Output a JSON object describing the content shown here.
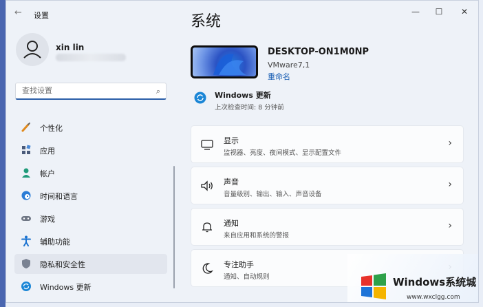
{
  "window": {
    "title": "设置",
    "controls": {
      "minimize": "—",
      "maximize": "☐",
      "close": "✕"
    }
  },
  "user": {
    "name": "xin lin"
  },
  "search": {
    "placeholder": "查找设置"
  },
  "sidebar": {
    "items": [
      {
        "label": "个性化",
        "icon": "brush-icon"
      },
      {
        "label": "应用",
        "icon": "apps-icon"
      },
      {
        "label": "帐户",
        "icon": "account-icon"
      },
      {
        "label": "时间和语言",
        "icon": "globe-clock-icon"
      },
      {
        "label": "游戏",
        "icon": "gamepad-icon"
      },
      {
        "label": "辅助功能",
        "icon": "accessibility-icon"
      },
      {
        "label": "隐私和安全性",
        "icon": "shield-icon",
        "selected": true
      },
      {
        "label": "Windows 更新",
        "icon": "update-icon"
      }
    ]
  },
  "main": {
    "title": "系统",
    "device": {
      "name": "DESKTOP-ON1M0NP",
      "model": "VMware7,1",
      "rename": "重命名"
    },
    "update": {
      "title": "Windows 更新",
      "subtitle": "上次检查时间: 8 分钟前"
    },
    "cards": [
      {
        "title": "显示",
        "subtitle": "监视器、亮度、夜间模式、显示配置文件",
        "icon": "display-icon"
      },
      {
        "title": "声音",
        "subtitle": "音量级别、输出、输入、声音设备",
        "icon": "speaker-icon"
      },
      {
        "title": "通知",
        "subtitle": "来自应用和系统的警报",
        "icon": "bell-icon"
      },
      {
        "title": "专注助手",
        "subtitle": "通知、自动规则",
        "icon": "moon-icon"
      }
    ]
  },
  "watermark": {
    "title": "Windows系统城",
    "url": "www.wxclgg.com"
  },
  "colors": {
    "accent": "#1a5fb4",
    "selected_bg": "#e2e6ee",
    "window_bg": "#eef2f8"
  }
}
